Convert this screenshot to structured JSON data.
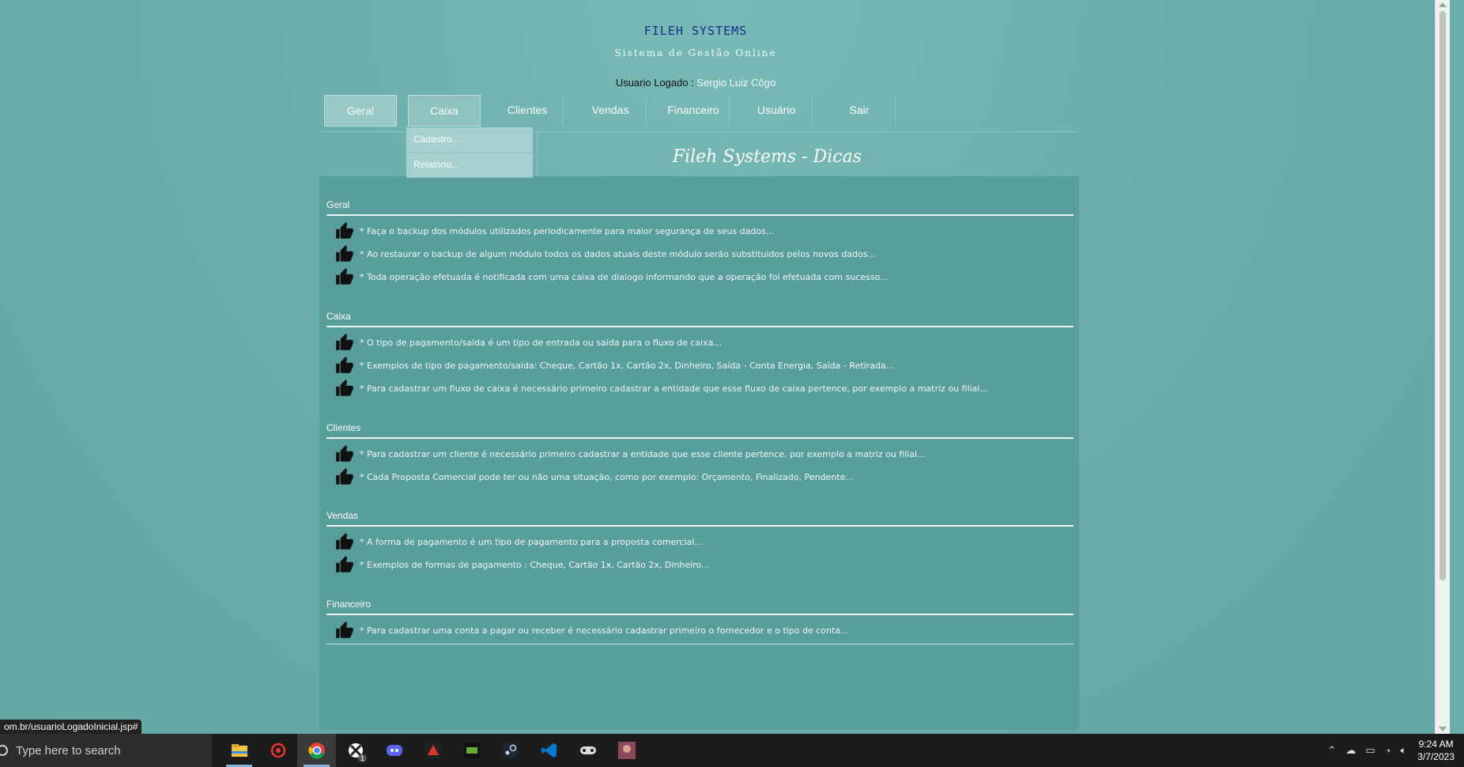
{
  "header": {
    "brand": "FILEH SYSTEMS",
    "tagline": "Sistema de Gestão Online",
    "user_label": "Usuario Logado :",
    "user_name": "Sergio Luiz Côgo"
  },
  "nav": {
    "tabs": [
      {
        "label": "Geral"
      },
      {
        "label": "Caixa"
      },
      {
        "label": "Clientes"
      },
      {
        "label": "Vendas"
      },
      {
        "label": "Financeiro"
      },
      {
        "label": "Usuário"
      },
      {
        "label": "Sair"
      }
    ],
    "dropdown": [
      "Cadastro...",
      "Relatório..."
    ]
  },
  "page_title": "Fileh Systems - Dicas",
  "sections": [
    {
      "title": "Geral",
      "tips": [
        "* Faça o backup dos módulos utilizados periodicamente para maior segurança de seus dados...",
        "* Ao restaurar o backup de algum módulo todos os dados atuais deste módulo serão substituidos pelos novos dados...",
        "* Toda operação efetuada é notificada com uma caixa de dialogo informando que a operação foi efetuada com sucesso..."
      ]
    },
    {
      "title": "Caixa",
      "tips": [
        "* O tipo de pagamento/saída é um tipo de entrada ou saída para o fluxo de caixa...",
        "* Exemplos de tipo de pagamento/saída: Cheque, Cartão 1x, Cartão 2x, Dinheiro, Saída - Conta Energia, Saída - Retirada...",
        "* Para cadastrar um fluxo de caixa é necessário primeiro cadastrar a entidade que esse fluxo de caixa pertence, por exemplo a matriz ou filial..."
      ]
    },
    {
      "title": "Clientes",
      "tips": [
        "* Para cadastrar um cliente é necessário primeiro cadastrar a entidade que esse cliente pertence, por exemplo a matriz ou filial...",
        "* Cada Proposta Comercial pode ter ou não uma situação, como por exemplo: Orçamento, Finalizado, Pendente..."
      ]
    },
    {
      "title": "Vendas",
      "tips": [
        "* A forma de pagamento é um tipo de pagamento para a proposta comercial...",
        "* Exemplos de formas de pagamento : Cheque, Cartão 1x, Cartão 2x, Dinheiro..."
      ]
    },
    {
      "title": "Financeiro",
      "tips": [
        "* Para cadastrar uma conta a pagar ou receber é necessário cadastrar primeiro o fornecedor e o tipo de conta..."
      ]
    }
  ],
  "status_url": "om.br/usuarioLogadoInicial.jsp#",
  "taskbar": {
    "search_placeholder": "Type here to search",
    "apps": [
      "file-explorer-icon",
      "antivirus-icon",
      "chrome-icon",
      "xbox-icon",
      "discord-icon",
      "game-launcher-icon",
      "terminal-icon",
      "steam-icon",
      "vscode-icon",
      "controller-icon",
      "game-avatar-icon"
    ],
    "xbox_badge": "1",
    "time": "9:24 AM",
    "date": "3/7/2023"
  }
}
